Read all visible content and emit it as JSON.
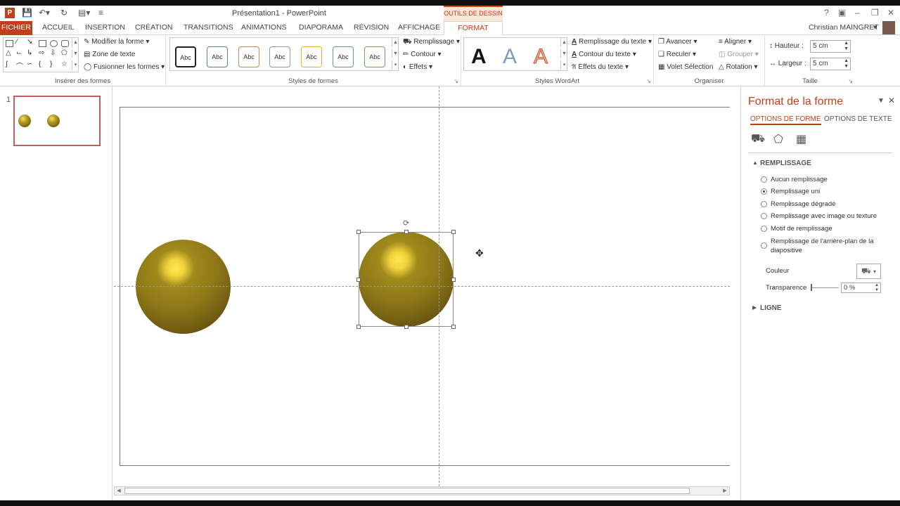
{
  "app": {
    "window_title": "Présentation1 - PowerPoint",
    "contextual_tab_group": "OUTILS DE DESSIN",
    "user_name": "Christian MAINGRET"
  },
  "tabs": [
    "FICHIER",
    "ACCUEIL",
    "INSERTION",
    "CRÉATION",
    "TRANSITIONS",
    "ANIMATIONS",
    "DIAPORAMA",
    "RÉVISION",
    "AFFICHAGE",
    "FORMAT"
  ],
  "ribbon": {
    "insert_shapes": {
      "label": "Insérer des formes",
      "edit_shape": "Modifier la forme",
      "text_box": "Zone de texte",
      "merge_shapes": "Fusionner les formes"
    },
    "shape_styles": {
      "label": "Styles de formes",
      "style_samples": [
        "Abc",
        "Abc",
        "Abc",
        "Abc",
        "Abc",
        "Abc",
        "Abc"
      ],
      "fill": "Remplissage",
      "outline": "Contour",
      "effects": "Effets"
    },
    "wordart": {
      "label": "Styles WordArt",
      "samples": [
        "A",
        "A",
        "A"
      ],
      "text_fill": "Remplissage du texte",
      "text_outline": "Contour du texte",
      "text_effects": "Effets du texte"
    },
    "arrange": {
      "label": "Organiser",
      "bring_forward": "Avancer",
      "send_backward": "Reculer",
      "selection_pane": "Volet Sélection",
      "align": "Aligner",
      "group": "Grouper",
      "rotate": "Rotation"
    },
    "size": {
      "label": "Taille",
      "height_label": "Hauteur :",
      "height_value": "5 cm",
      "width_label": "Largeur :",
      "width_value": "5 cm"
    }
  },
  "slides_pane": {
    "slide_number": "1"
  },
  "format_pane": {
    "title": "Format de la forme",
    "tab_shape_options": "OPTIONS DE FORME",
    "tab_text_options": "OPTIONS DE TEXTE",
    "fill_section": "REMPLISSAGE",
    "fill_options": [
      {
        "label": "Aucun remplissage",
        "selected": false
      },
      {
        "label": "Remplissage uni",
        "selected": true
      },
      {
        "label": "Remplissage dégradé",
        "selected": false
      },
      {
        "label": "Remplissage avec image ou texture",
        "selected": false
      },
      {
        "label": "Motif de remplissage",
        "selected": false
      },
      {
        "label": "Remplissage de l'arrière-plan de la diapositive",
        "selected": false
      }
    ],
    "color_label": "Couleur",
    "transparency_label": "Transparence",
    "transparency_value": "0 %",
    "line_section": "LIGNE"
  },
  "colors": {
    "accent": "#c43e1c",
    "ball_gold": "#8c7618",
    "ball_highlight": "#ffe85a"
  }
}
